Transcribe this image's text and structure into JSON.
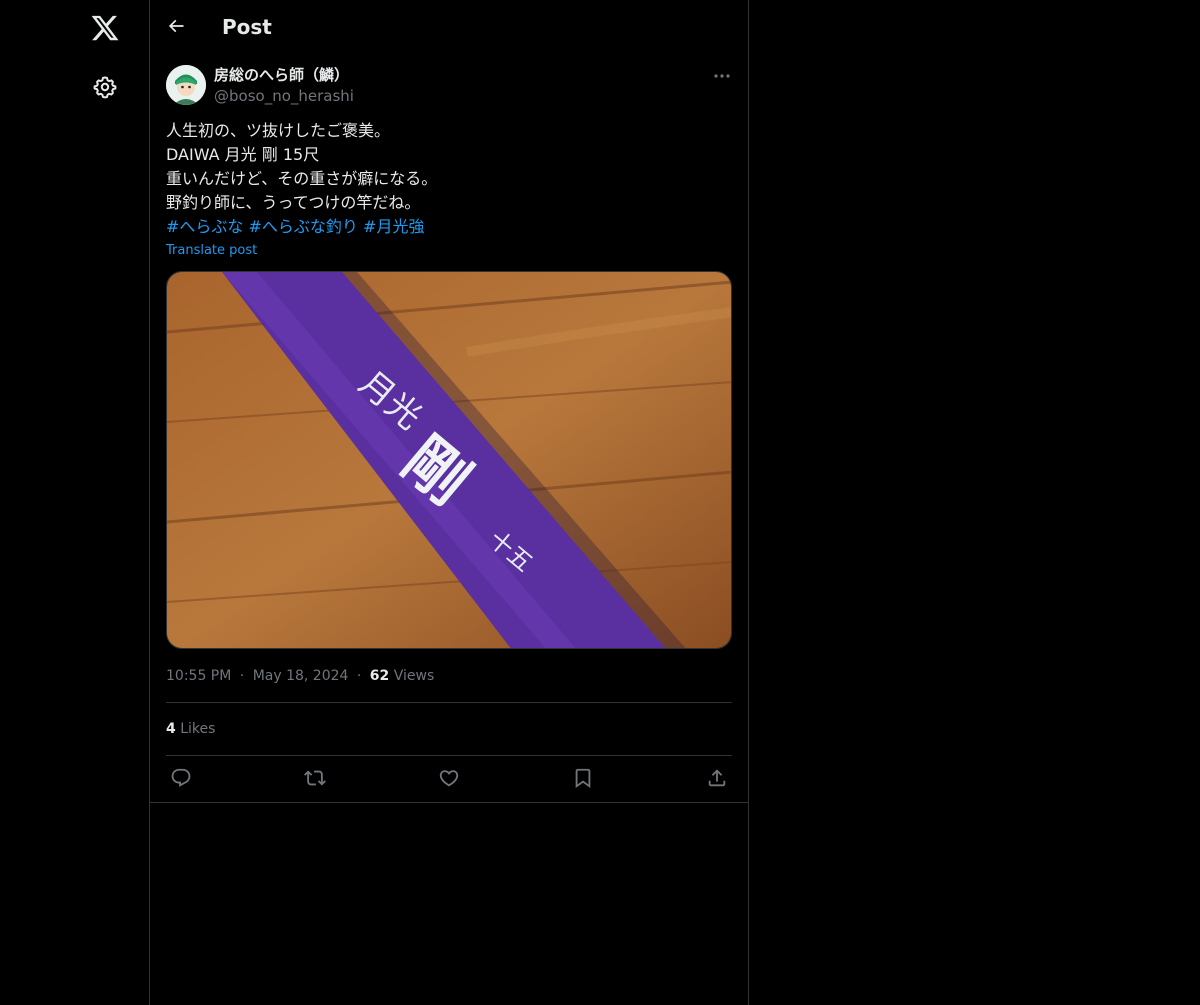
{
  "nav": {
    "logo_icon": "x-logo-icon",
    "settings_icon": "gear-icon"
  },
  "header": {
    "title": "Post"
  },
  "post": {
    "author_name": "房総のへら師（鱗）",
    "author_handle": "@boso_no_herashi",
    "lines": [
      "人生初の、ツ抜けしたご褒美。",
      "DAIWA 月光 剛 15尺",
      "重いんだけど、その重さが癖になる。",
      "野釣り師に、うってつけの竿だね。"
    ],
    "hashtags": [
      "#へらぶな",
      "#へらぶな釣り",
      "#月光強"
    ],
    "translate": "Translate post",
    "time": "10:55 PM",
    "date": "May 18, 2024",
    "views_count": "62",
    "views_label": "Views",
    "likes_count": "4",
    "likes_label": "Likes",
    "dot": "·"
  },
  "image": {
    "title_text": "月光",
    "main_char": "剛",
    "number": "十五"
  },
  "colors": {
    "accent": "#1d9bf0",
    "background": "#000000",
    "border": "#2f3336",
    "muted": "#71767b",
    "rod": "#5a2fa0"
  }
}
